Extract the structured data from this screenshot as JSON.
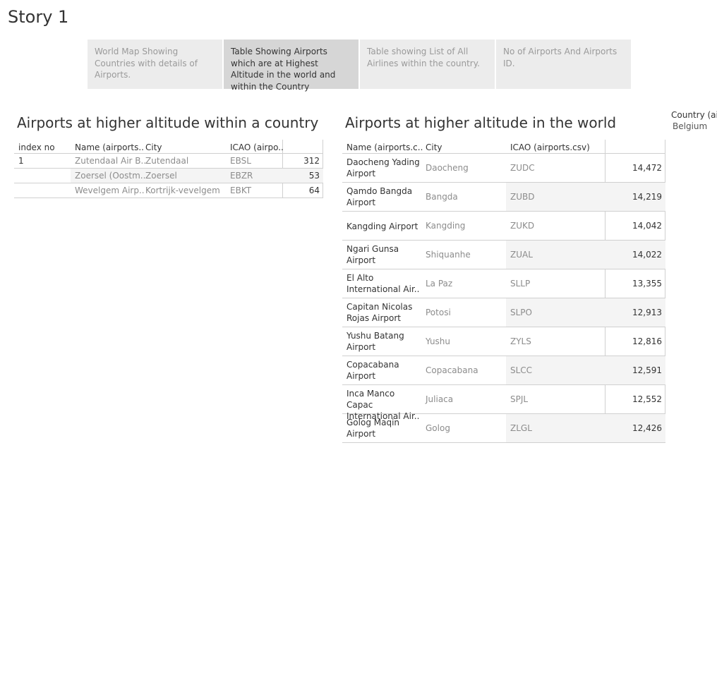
{
  "story": {
    "title": "Story 1"
  },
  "tabs": [
    {
      "label": "World Map Showing Countries with details of Airports.",
      "active": false
    },
    {
      "label": "Table Showing Airports which are at Highest Altitude in the world and within the Country",
      "active": true
    },
    {
      "label": "Table showing List of All Airlines within the country.",
      "active": false
    },
    {
      "label": "No of Airports And Airports ID.",
      "active": false
    }
  ],
  "country_sheet": {
    "title": "Airports at  higher altitude within a country",
    "headers": [
      "index no",
      "Name (airports..",
      "City",
      "ICAO (airpo..",
      ""
    ],
    "index": "1",
    "rows": [
      {
        "name": "Zutendaal Air B..",
        "city": "Zutendaal",
        "icao": "EBSL",
        "altitude": "312"
      },
      {
        "name": "Zoersel (Oostm..",
        "city": "Zoersel",
        "icao": "EBZR",
        "altitude": "53"
      },
      {
        "name": "Wevelgem Airp..",
        "city": "Kortrijk-vevelgem",
        "icao": "EBKT",
        "altitude": "64"
      }
    ]
  },
  "world_sheet": {
    "title": "Airports at higher altitude in the world",
    "headers": [
      "Name (airports.c..",
      "City",
      "ICAO (airports.csv)",
      ""
    ],
    "rows": [
      {
        "name": "Daocheng Yading Airport",
        "city": "Daocheng",
        "icao": "ZUDC",
        "altitude": "14,472"
      },
      {
        "name": "Qamdo Bangda Airport",
        "city": "Bangda",
        "icao": "ZUBD",
        "altitude": "14,219"
      },
      {
        "name": "Kangding Airport",
        "city": "Kangding",
        "icao": "ZUKD",
        "altitude": "14,042"
      },
      {
        "name": "Ngari Gunsa Airport",
        "city": "Shiquanhe",
        "icao": "ZUAL",
        "altitude": "14,022"
      },
      {
        "name": "El Alto International Air..",
        "city": "La Paz",
        "icao": "SLLP",
        "altitude": "13,355"
      },
      {
        "name": "Capitan Nicolas Rojas Airport",
        "city": "Potosi",
        "icao": "SLPO",
        "altitude": "12,913"
      },
      {
        "name": "Yushu Batang Airport",
        "city": "Yushu",
        "icao": "ZYLS",
        "altitude": "12,816"
      },
      {
        "name": "Copacabana Airport",
        "city": "Copacabana",
        "icao": "SLCC",
        "altitude": "12,591"
      },
      {
        "name": "Inca Manco Capac International Air..",
        "city": "Juliaca",
        "icao": "SPJL",
        "altitude": "12,552"
      },
      {
        "name": "Golog Maqin Airport",
        "city": "Golog",
        "icao": "ZLGL",
        "altitude": "12,426"
      }
    ]
  },
  "filter": {
    "label": "Country (ai",
    "value": "Belgium"
  }
}
